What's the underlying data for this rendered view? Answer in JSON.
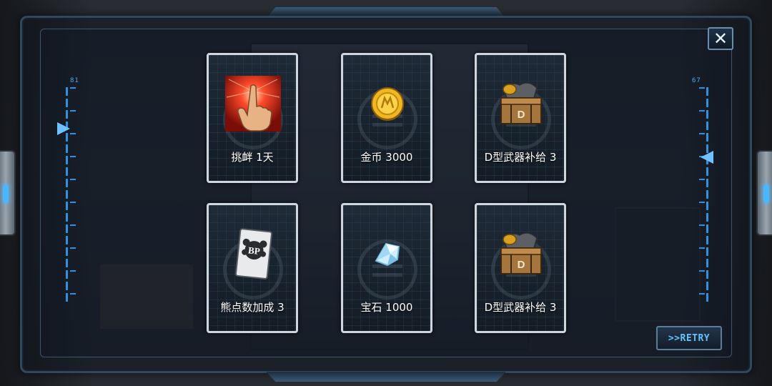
{
  "gauges": {
    "left_label": "81",
    "right_label": "67"
  },
  "close_button": {
    "icon": "close-icon",
    "label": "✕"
  },
  "rewards": [
    {
      "icon": "taunt-finger-icon",
      "label": "挑衅 1天"
    },
    {
      "icon": "gold-coin-icon",
      "label": "金币 3000"
    },
    {
      "icon": "weapon-supply-crate-icon",
      "label": "D型武器补给 3"
    },
    {
      "icon": "bp-card-icon",
      "label": "熊点数加成 3"
    },
    {
      "icon": "gem-crystal-icon",
      "label": "宝石 1000"
    },
    {
      "icon": "weapon-supply-crate-icon",
      "label": "D型武器补给 3"
    }
  ],
  "retry_button": {
    "label": ">>RETRY"
  },
  "colors": {
    "accent": "#63c4ff",
    "card_border": "#cfd6dd",
    "frame": "#31475d"
  }
}
